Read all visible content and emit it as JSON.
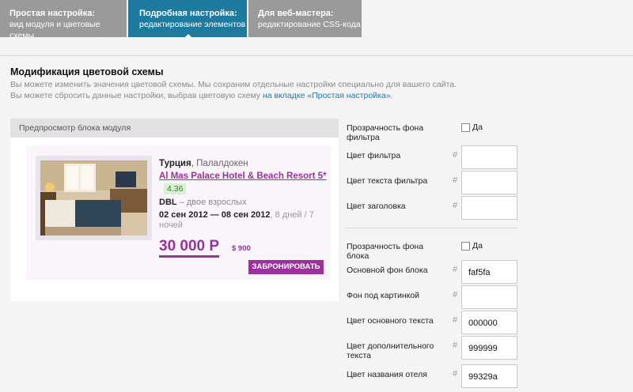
{
  "tabs": [
    {
      "title": "Простая настройка:",
      "subtitle": "вид модуля и цветовые схемы"
    },
    {
      "title": "Подробная настройка:",
      "subtitle": "редактирование элементов"
    },
    {
      "title": "Для веб-мастера:",
      "subtitle": "редактирование CSS-кода"
    }
  ],
  "section": {
    "title": "Модификация цветовой схемы",
    "desc_line1": "Вы можете изменить значения цветовой схемы. Мы сохраним отдельные настройки специально для вашего сайта.",
    "desc_line2_prefix": "Вы можете сбросить данные настройки, выбрав цветовую схему ",
    "desc_line2_link": "на вкладке «Простая настройка»",
    "desc_line2_suffix": "."
  },
  "preview": {
    "header": "Предпросмотр блока модуля",
    "country": "Турция",
    "city": ", Палалдокен",
    "hotel": "Al Mas Palace Hotel & Beach Resort 5*",
    "rating": "4.36",
    "room_type": "DBL",
    "room_desc": " – двое взрослых",
    "dates": "02 сен 2012 — 08 сен 2012",
    "duration": ", 8 дней / 7 ночей",
    "price": "30 000 Р",
    "price_usd": "$ 900",
    "book_button": "ЗАБРОНИРОВАТЬ"
  },
  "form": {
    "filter_bg_transparency": {
      "label": "Прозрачность фона фильтра",
      "checkbox_label": "Да"
    },
    "filter_color": {
      "label": "Цвет фильтра",
      "hash": "#",
      "value": ""
    },
    "filter_text_color": {
      "label": "Цвет текста фильтра",
      "hash": "#",
      "value": ""
    },
    "header_color": {
      "label": "Цвет заголовка",
      "hash": "#",
      "value": ""
    },
    "block_bg_transparency": {
      "label": "Прозрачность фона блока",
      "checkbox_label": "Да"
    },
    "block_main_bg": {
      "label": "Основной фон блока",
      "hash": "#",
      "value": "faf5fa"
    },
    "image_bg": {
      "label": "Фон под картинкой",
      "hash": "#",
      "value": ""
    },
    "main_text_color": {
      "label": "Цвет основного текста",
      "hash": "#",
      "value": "000000"
    },
    "extra_text_color": {
      "label": "Цвет дополнительного текста",
      "hash": "#",
      "value": "999999"
    },
    "hotel_name_color": {
      "label": "Цвет названия отеля",
      "hash": "#",
      "value": "99329a"
    }
  },
  "colors": {
    "accent": "#1f7aa0",
    "tab_inactive": "#9a9a9a",
    "hotel_purple": "#99329a",
    "block_bg": "#faf5fa",
    "rating_bg": "#d9efd6"
  }
}
